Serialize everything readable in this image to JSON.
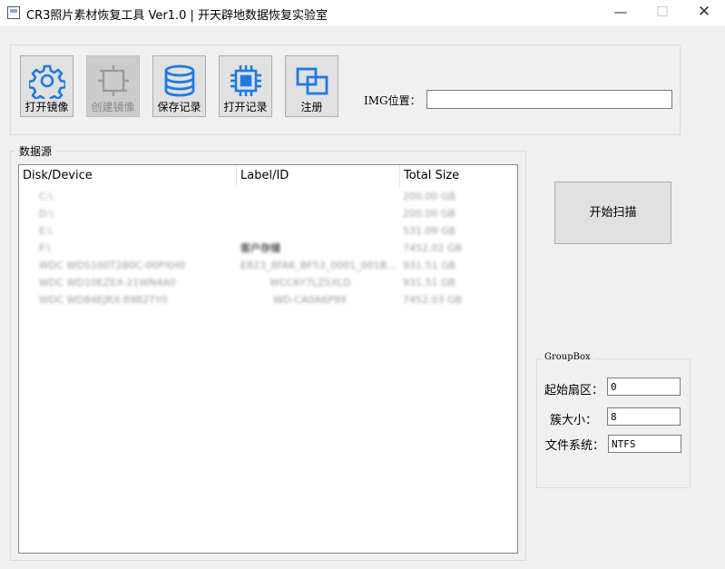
{
  "window": {
    "title": "CR3照片素材恢复工具 Ver1.0 | 开天辟地数据恢复实验室",
    "min_glyph": "—",
    "max_glyph": "☐",
    "close_glyph": "✕"
  },
  "toolbar": {
    "buttons": [
      {
        "label": "打开镜像",
        "icon": "gear-icon",
        "enabled": true
      },
      {
        "label": "创建镜像",
        "icon": "crop-icon",
        "enabled": false
      },
      {
        "label": "保存记录",
        "icon": "database-icon",
        "enabled": true
      },
      {
        "label": "打开记录",
        "icon": "chip-icon",
        "enabled": true
      },
      {
        "label": "注册",
        "icon": "overlap-squares-icon",
        "enabled": true
      }
    ],
    "img_label": "IMG位置：",
    "img_value": ""
  },
  "datasource": {
    "title": "数据源",
    "columns": [
      "Disk/Device",
      "Label/ID",
      "Total Size"
    ],
    "rows": [
      {
        "device": "C:\\",
        "label": "",
        "size": "200.00 GB"
      },
      {
        "device": "D:\\",
        "label": "",
        "size": "200.00 GB"
      },
      {
        "device": "E:\\",
        "label": "",
        "size": "531.09 GB"
      },
      {
        "device": "F:\\",
        "label": "客户存储",
        "size": "7452.02 GB"
      },
      {
        "device": "WDC WDS100T2B0C-00PXH0",
        "label": "E823_8FA6_BF53_0001_001B...",
        "size": "931.51 GB"
      },
      {
        "device": "WDC WD10EZEX-21WN4A0",
        "label": "WCC6Y7LZSXLD",
        "size": "931.51 GB"
      },
      {
        "device": "WDC WD84EJRX-89B2TY0",
        "label": "WD-CA0A6P9X",
        "size": "7452.03 GB"
      }
    ]
  },
  "scan": {
    "label": "开始扫描"
  },
  "groupbox": {
    "title": "GroupBox",
    "start_sector_label": "起始扇区：",
    "start_sector_value": "0",
    "cluster_label": "簇大小：",
    "cluster_value": "8",
    "fs_label": "文件系统：",
    "fs_value": "NTFS"
  },
  "colors": {
    "icon_blue": "#1f7ae0",
    "icon_disabled": "#9a9a9a"
  }
}
